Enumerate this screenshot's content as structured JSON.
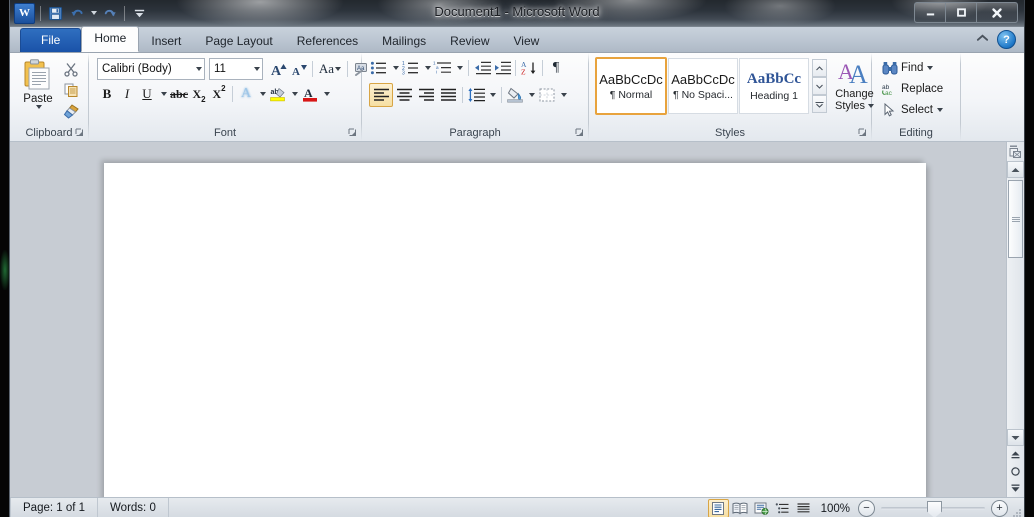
{
  "window": {
    "title": "Document1  -  Microsoft Word",
    "app_icon": "word-icon",
    "minimize_label": "—",
    "maximize_label": "□",
    "close_label": "✕"
  },
  "quick_access": {
    "items": [
      {
        "name": "save-icon",
        "label": "Save"
      },
      {
        "name": "undo-icon",
        "label": "Undo"
      },
      {
        "name": "redo-icon",
        "label": "Redo"
      },
      {
        "name": "customize-qat-icon",
        "label": "Customize Quick Access Toolbar"
      }
    ]
  },
  "ribbon": {
    "tabs": [
      {
        "label": "File",
        "active": false,
        "type": "file"
      },
      {
        "label": "Home",
        "active": true,
        "type": "tab"
      },
      {
        "label": "Insert",
        "active": false,
        "type": "tab"
      },
      {
        "label": "Page Layout",
        "active": false,
        "type": "tab"
      },
      {
        "label": "References",
        "active": false,
        "type": "tab"
      },
      {
        "label": "Mailings",
        "active": false,
        "type": "tab"
      },
      {
        "label": "Review",
        "active": false,
        "type": "tab"
      },
      {
        "label": "View",
        "active": false,
        "type": "tab"
      }
    ],
    "collapse_label": "▲",
    "help_label": "?",
    "groups": {
      "clipboard": {
        "label": "Clipboard",
        "paste_label": "Paste",
        "cut_label": "Cut",
        "copy_label": "Copy",
        "format_painter_label": "Format Painter"
      },
      "font": {
        "label": "Font",
        "font_name": "Calibri (Body)",
        "font_size": "11",
        "grow_font_label": "Grow Font",
        "shrink_font_label": "Shrink Font",
        "change_case_label": "Aa",
        "clear_formatting_label": "Clear Formatting",
        "bold_label": "B",
        "italic_label": "I",
        "underline_label": "U",
        "strikethrough_label": "abc",
        "subscript_label": "X",
        "superscript_label": "X",
        "text_effects_label": "A",
        "highlight_label": "ab",
        "font_color_label": "A",
        "highlight_color": "#ffff00",
        "font_color": "#d81616"
      },
      "paragraph": {
        "label": "Paragraph",
        "bullets_label": "Bullets",
        "numbering_label": "Numbering",
        "multilevel_label": "Multilevel List",
        "decrease_indent_label": "Decrease Indent",
        "increase_indent_label": "Increase Indent",
        "sort_label": "Sort",
        "show_marks_label": "¶",
        "align_left_label": "Align Text Left",
        "align_center_label": "Center",
        "align_right_label": "Align Text Right",
        "justify_label": "Justify",
        "line_spacing_label": "Line and Paragraph Spacing",
        "shading_label": "Shading",
        "borders_label": "Borders",
        "active_alignment": "align-left"
      },
      "styles": {
        "label": "Styles",
        "items": [
          {
            "sample": "AaBbCcDc",
            "name": "¶ Normal",
            "selected": true,
            "kind": "body"
          },
          {
            "sample": "AaBbCcDc",
            "name": "¶ No Spaci...",
            "selected": false,
            "kind": "body"
          },
          {
            "sample": "AaBbCс",
            "name": "Heading 1",
            "selected": false,
            "kind": "heading"
          }
        ],
        "scroll_up_label": "▲",
        "scroll_down_label": "▼",
        "more_label": "▾",
        "change_styles_label": "Change\nStyles",
        "change_styles_line1": "Change",
        "change_styles_line2": "Styles"
      },
      "editing": {
        "label": "Editing",
        "find_label": "Find",
        "replace_label": "Replace",
        "select_label": "Select"
      }
    }
  },
  "document": {
    "page_background": "#ffffff",
    "work_background": "#c7ccd3"
  },
  "scrollbar": {
    "up_label": "▲",
    "down_label": "▼",
    "previous_page_label": "Previous Page",
    "select_browse_object_label": "Select Browse Object",
    "next_page_label": "Next Page",
    "select_object_label": "Select Browse Object"
  },
  "status": {
    "page_text": "Page: 1 of 1",
    "words_text": "Words: 0",
    "views": [
      {
        "name": "print-layout-view",
        "label": "Print Layout",
        "active": true
      },
      {
        "name": "full-screen-reading-view",
        "label": "Full Screen Reading",
        "active": false
      },
      {
        "name": "web-layout-view",
        "label": "Web Layout",
        "active": false
      },
      {
        "name": "outline-view",
        "label": "Outline",
        "active": false
      },
      {
        "name": "draft-view",
        "label": "Draft",
        "active": false
      }
    ],
    "zoom_level": "100%",
    "zoom_out_label": "−",
    "zoom_in_label": "+"
  }
}
